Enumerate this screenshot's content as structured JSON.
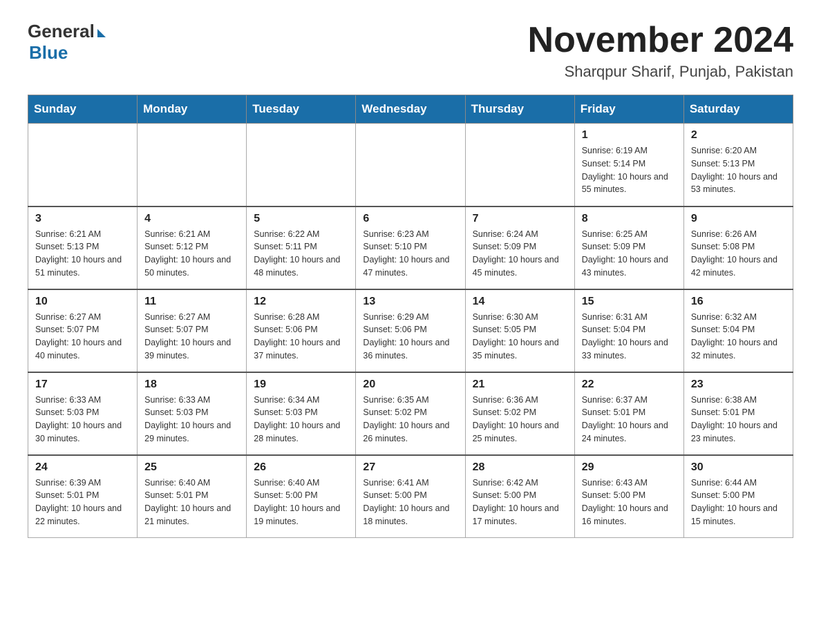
{
  "header": {
    "logo_general": "General",
    "logo_blue": "Blue",
    "month_title": "November 2024",
    "location": "Sharqpur Sharif, Punjab, Pakistan"
  },
  "days_of_week": [
    "Sunday",
    "Monday",
    "Tuesday",
    "Wednesday",
    "Thursday",
    "Friday",
    "Saturday"
  ],
  "weeks": [
    [
      {
        "day": "",
        "sunrise": "",
        "sunset": "",
        "daylight": ""
      },
      {
        "day": "",
        "sunrise": "",
        "sunset": "",
        "daylight": ""
      },
      {
        "day": "",
        "sunrise": "",
        "sunset": "",
        "daylight": ""
      },
      {
        "day": "",
        "sunrise": "",
        "sunset": "",
        "daylight": ""
      },
      {
        "day": "",
        "sunrise": "",
        "sunset": "",
        "daylight": ""
      },
      {
        "day": "1",
        "sunrise": "Sunrise: 6:19 AM",
        "sunset": "Sunset: 5:14 PM",
        "daylight": "Daylight: 10 hours and 55 minutes."
      },
      {
        "day": "2",
        "sunrise": "Sunrise: 6:20 AM",
        "sunset": "Sunset: 5:13 PM",
        "daylight": "Daylight: 10 hours and 53 minutes."
      }
    ],
    [
      {
        "day": "3",
        "sunrise": "Sunrise: 6:21 AM",
        "sunset": "Sunset: 5:13 PM",
        "daylight": "Daylight: 10 hours and 51 minutes."
      },
      {
        "day": "4",
        "sunrise": "Sunrise: 6:21 AM",
        "sunset": "Sunset: 5:12 PM",
        "daylight": "Daylight: 10 hours and 50 minutes."
      },
      {
        "day": "5",
        "sunrise": "Sunrise: 6:22 AM",
        "sunset": "Sunset: 5:11 PM",
        "daylight": "Daylight: 10 hours and 48 minutes."
      },
      {
        "day": "6",
        "sunrise": "Sunrise: 6:23 AM",
        "sunset": "Sunset: 5:10 PM",
        "daylight": "Daylight: 10 hours and 47 minutes."
      },
      {
        "day": "7",
        "sunrise": "Sunrise: 6:24 AM",
        "sunset": "Sunset: 5:09 PM",
        "daylight": "Daylight: 10 hours and 45 minutes."
      },
      {
        "day": "8",
        "sunrise": "Sunrise: 6:25 AM",
        "sunset": "Sunset: 5:09 PM",
        "daylight": "Daylight: 10 hours and 43 minutes."
      },
      {
        "day": "9",
        "sunrise": "Sunrise: 6:26 AM",
        "sunset": "Sunset: 5:08 PM",
        "daylight": "Daylight: 10 hours and 42 minutes."
      }
    ],
    [
      {
        "day": "10",
        "sunrise": "Sunrise: 6:27 AM",
        "sunset": "Sunset: 5:07 PM",
        "daylight": "Daylight: 10 hours and 40 minutes."
      },
      {
        "day": "11",
        "sunrise": "Sunrise: 6:27 AM",
        "sunset": "Sunset: 5:07 PM",
        "daylight": "Daylight: 10 hours and 39 minutes."
      },
      {
        "day": "12",
        "sunrise": "Sunrise: 6:28 AM",
        "sunset": "Sunset: 5:06 PM",
        "daylight": "Daylight: 10 hours and 37 minutes."
      },
      {
        "day": "13",
        "sunrise": "Sunrise: 6:29 AM",
        "sunset": "Sunset: 5:06 PM",
        "daylight": "Daylight: 10 hours and 36 minutes."
      },
      {
        "day": "14",
        "sunrise": "Sunrise: 6:30 AM",
        "sunset": "Sunset: 5:05 PM",
        "daylight": "Daylight: 10 hours and 35 minutes."
      },
      {
        "day": "15",
        "sunrise": "Sunrise: 6:31 AM",
        "sunset": "Sunset: 5:04 PM",
        "daylight": "Daylight: 10 hours and 33 minutes."
      },
      {
        "day": "16",
        "sunrise": "Sunrise: 6:32 AM",
        "sunset": "Sunset: 5:04 PM",
        "daylight": "Daylight: 10 hours and 32 minutes."
      }
    ],
    [
      {
        "day": "17",
        "sunrise": "Sunrise: 6:33 AM",
        "sunset": "Sunset: 5:03 PM",
        "daylight": "Daylight: 10 hours and 30 minutes."
      },
      {
        "day": "18",
        "sunrise": "Sunrise: 6:33 AM",
        "sunset": "Sunset: 5:03 PM",
        "daylight": "Daylight: 10 hours and 29 minutes."
      },
      {
        "day": "19",
        "sunrise": "Sunrise: 6:34 AM",
        "sunset": "Sunset: 5:03 PM",
        "daylight": "Daylight: 10 hours and 28 minutes."
      },
      {
        "day": "20",
        "sunrise": "Sunrise: 6:35 AM",
        "sunset": "Sunset: 5:02 PM",
        "daylight": "Daylight: 10 hours and 26 minutes."
      },
      {
        "day": "21",
        "sunrise": "Sunrise: 6:36 AM",
        "sunset": "Sunset: 5:02 PM",
        "daylight": "Daylight: 10 hours and 25 minutes."
      },
      {
        "day": "22",
        "sunrise": "Sunrise: 6:37 AM",
        "sunset": "Sunset: 5:01 PM",
        "daylight": "Daylight: 10 hours and 24 minutes."
      },
      {
        "day": "23",
        "sunrise": "Sunrise: 6:38 AM",
        "sunset": "Sunset: 5:01 PM",
        "daylight": "Daylight: 10 hours and 23 minutes."
      }
    ],
    [
      {
        "day": "24",
        "sunrise": "Sunrise: 6:39 AM",
        "sunset": "Sunset: 5:01 PM",
        "daylight": "Daylight: 10 hours and 22 minutes."
      },
      {
        "day": "25",
        "sunrise": "Sunrise: 6:40 AM",
        "sunset": "Sunset: 5:01 PM",
        "daylight": "Daylight: 10 hours and 21 minutes."
      },
      {
        "day": "26",
        "sunrise": "Sunrise: 6:40 AM",
        "sunset": "Sunset: 5:00 PM",
        "daylight": "Daylight: 10 hours and 19 minutes."
      },
      {
        "day": "27",
        "sunrise": "Sunrise: 6:41 AM",
        "sunset": "Sunset: 5:00 PM",
        "daylight": "Daylight: 10 hours and 18 minutes."
      },
      {
        "day": "28",
        "sunrise": "Sunrise: 6:42 AM",
        "sunset": "Sunset: 5:00 PM",
        "daylight": "Daylight: 10 hours and 17 minutes."
      },
      {
        "day": "29",
        "sunrise": "Sunrise: 6:43 AM",
        "sunset": "Sunset: 5:00 PM",
        "daylight": "Daylight: 10 hours and 16 minutes."
      },
      {
        "day": "30",
        "sunrise": "Sunrise: 6:44 AM",
        "sunset": "Sunset: 5:00 PM",
        "daylight": "Daylight: 10 hours and 15 minutes."
      }
    ]
  ]
}
